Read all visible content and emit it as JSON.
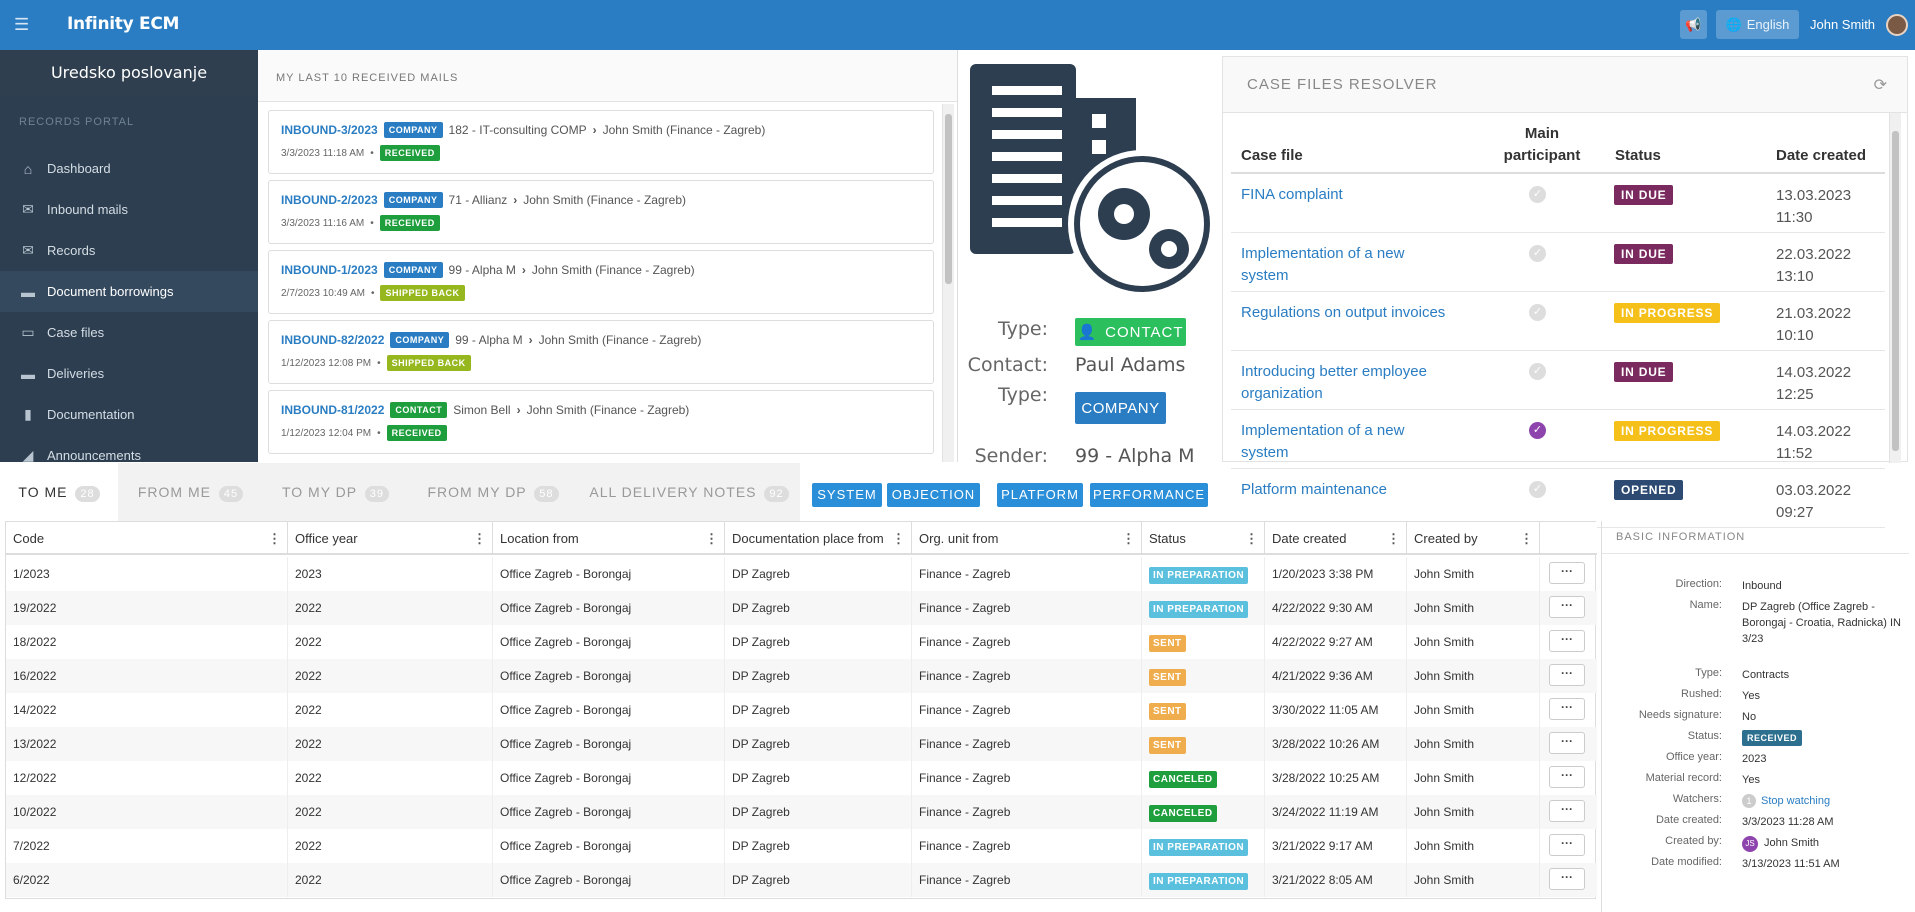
{
  "header": {
    "brand": "Infinity ECM",
    "language": "English",
    "user": "John Smith"
  },
  "sidebar": {
    "title": "Uredsko poslovanje",
    "section": "RECORDS PORTAL",
    "items": [
      {
        "label": "Dashboard",
        "icon": "home-icon"
      },
      {
        "label": "Inbound mails",
        "icon": "envelope-open-icon"
      },
      {
        "label": "Records",
        "icon": "envelope-icon"
      },
      {
        "label": "Document borrowings",
        "icon": "folder-icon"
      },
      {
        "label": "Case files",
        "icon": "folder-open-icon"
      },
      {
        "label": "Deliveries",
        "icon": "folder-icon"
      },
      {
        "label": "Documentation",
        "icon": "book-icon"
      },
      {
        "label": "Announcements",
        "icon": "bullhorn-icon"
      }
    ]
  },
  "mails": {
    "title": "MY LAST 10 RECEIVED MAILS",
    "items": [
      {
        "code": "INBOUND-3/2023",
        "type": "COMPANY",
        "from": "182 - IT-consulting COMP",
        "to": "John Smith (Finance - Zagreb)",
        "date": "3/3/2023 11:18 AM",
        "status": "RECEIVED"
      },
      {
        "code": "INBOUND-2/2023",
        "type": "COMPANY",
        "from": "71 - Allianz",
        "to": "John Smith (Finance - Zagreb)",
        "date": "3/3/2023 11:16 AM",
        "status": "RECEIVED"
      },
      {
        "code": "INBOUND-1/2023",
        "type": "COMPANY",
        "from": "99 - Alpha M",
        "to": "John Smith (Finance - Zagreb)",
        "date": "2/7/2023 10:49 AM",
        "status": "SHIPPED BACK"
      },
      {
        "code": "INBOUND-82/2022",
        "type": "COMPANY",
        "from": "99 - Alpha M",
        "to": "John Smith (Finance - Zagreb)",
        "date": "1/12/2023 12:08 PM",
        "status": "SHIPPED BACK"
      },
      {
        "code": "INBOUND-81/2022",
        "type": "CONTACT",
        "from": "Simon Bell",
        "to": "John Smith (Finance - Zagreb)",
        "date": "1/12/2023 12:04 PM",
        "status": "RECEIVED"
      }
    ]
  },
  "sender_card": {
    "type_label": "Type:",
    "type1": "CONTACT",
    "contact_label": "Contact:",
    "contact": "Paul Adams",
    "type2": "COMPANY",
    "sender_label": "Sender:",
    "sender": "99 - Alpha M"
  },
  "resolver": {
    "title": "CASE FILES RESOLVER",
    "headers": {
      "case_file": "Case file",
      "main1": "Main",
      "main2": "participant",
      "status": "Status",
      "date": "Date created"
    },
    "rows": [
      {
        "name": "FINA complaint",
        "main": false,
        "status": "IN DUE",
        "date": "13.03.2023",
        "time": "11:30"
      },
      {
        "name": "Implementation of a new system",
        "main": false,
        "status": "IN DUE",
        "date": "22.03.2022",
        "time": "13:10"
      },
      {
        "name": "Regulations on output invoices",
        "main": false,
        "status": "IN PROGRESS",
        "date": "21.03.2022",
        "time": "10:10"
      },
      {
        "name": "Introducing better employee organization",
        "main": false,
        "status": "IN DUE",
        "date": "14.03.2022",
        "time": "12:25"
      },
      {
        "name": "Implementation of a new system",
        "main": true,
        "status": "IN PROGRESS",
        "date": "14.03.2022",
        "time": "11:52"
      },
      {
        "name": "Platform maintenance",
        "main": false,
        "status": "OPENED",
        "date": "03.03.2022",
        "time": "09:27"
      }
    ]
  },
  "tabs": [
    {
      "label": "TO ME",
      "count": "28"
    },
    {
      "label": "FROM ME",
      "count": "45"
    },
    {
      "label": "TO MY DP",
      "count": "39"
    },
    {
      "label": "FROM MY DP",
      "count": "58"
    },
    {
      "label": "ALL DELIVERY NOTES",
      "count": "92"
    }
  ],
  "tags": [
    "SYSTEM",
    "OBJECTION",
    "PLATFORM",
    "PERFORMANCE"
  ],
  "grid": {
    "columns": [
      "Code",
      "Office year",
      "Location from",
      "Documentation place from",
      "Org. unit from",
      "Status",
      "Date created",
      "Created by"
    ],
    "rows": [
      {
        "code": "1/2023",
        "year": "2023",
        "loc": "Office Zagreb - Borongaj",
        "dp": "DP Zagreb",
        "org": "Finance - Zagreb",
        "status": "IN PREPARATION",
        "date": "1/20/2023 3:38 PM",
        "by": "John Smith"
      },
      {
        "code": "19/2022",
        "year": "2022",
        "loc": "Office Zagreb - Borongaj",
        "dp": "DP Zagreb",
        "org": "Finance - Zagreb",
        "status": "IN PREPARATION",
        "date": "4/22/2022 9:30 AM",
        "by": "John Smith"
      },
      {
        "code": "18/2022",
        "year": "2022",
        "loc": "Office Zagreb - Borongaj",
        "dp": "DP Zagreb",
        "org": "Finance - Zagreb",
        "status": "SENT",
        "date": "4/22/2022 9:27 AM",
        "by": "John Smith"
      },
      {
        "code": "16/2022",
        "year": "2022",
        "loc": "Office Zagreb - Borongaj",
        "dp": "DP Zagreb",
        "org": "Finance - Zagreb",
        "status": "SENT",
        "date": "4/21/2022 9:36 AM",
        "by": "John Smith"
      },
      {
        "code": "14/2022",
        "year": "2022",
        "loc": "Office Zagreb - Borongaj",
        "dp": "DP Zagreb",
        "org": "Finance - Zagreb",
        "status": "SENT",
        "date": "3/30/2022 11:05 AM",
        "by": "John Smith"
      },
      {
        "code": "13/2022",
        "year": "2022",
        "loc": "Office Zagreb - Borongaj",
        "dp": "DP Zagreb",
        "org": "Finance - Zagreb",
        "status": "SENT",
        "date": "3/28/2022 10:26 AM",
        "by": "John Smith"
      },
      {
        "code": "12/2022",
        "year": "2022",
        "loc": "Office Zagreb - Borongaj",
        "dp": "DP Zagreb",
        "org": "Finance - Zagreb",
        "status": "CANCELED",
        "date": "3/28/2022 10:25 AM",
        "by": "John Smith"
      },
      {
        "code": "10/2022",
        "year": "2022",
        "loc": "Office Zagreb - Borongaj",
        "dp": "DP Zagreb",
        "org": "Finance - Zagreb",
        "status": "CANCELED",
        "date": "3/24/2022 11:19 AM",
        "by": "John Smith"
      },
      {
        "code": "7/2022",
        "year": "2022",
        "loc": "Office Zagreb - Borongaj",
        "dp": "DP Zagreb",
        "org": "Finance - Zagreb",
        "status": "IN PREPARATION",
        "date": "3/21/2022 9:17 AM",
        "by": "John Smith"
      },
      {
        "code": "6/2022",
        "year": "2022",
        "loc": "Office Zagreb - Borongaj",
        "dp": "DP Zagreb",
        "org": "Finance - Zagreb",
        "status": "IN PREPARATION",
        "date": "3/21/2022 8:05 AM",
        "by": "John Smith"
      }
    ]
  },
  "info": {
    "title": "BASIC INFORMATION",
    "rows": [
      {
        "k": "Direction:",
        "v": "Inbound"
      },
      {
        "k": "Name:",
        "v": "DP Zagreb (Office Zagreb - Borongaj - Croatia, Radnicka) IN 3/23"
      },
      {
        "k": "Type:",
        "v": "Contracts"
      },
      {
        "k": "Rushed:",
        "v": "Yes"
      },
      {
        "k": "Needs signature:",
        "v": "No"
      },
      {
        "k": "Status:",
        "v": "RECEIVED"
      },
      {
        "k": "Office year:",
        "v": "2023"
      },
      {
        "k": "Material record:",
        "v": "Yes"
      },
      {
        "k": "Watchers:",
        "v": "Stop watching",
        "count": "1"
      },
      {
        "k": "Date created:",
        "v": "3/3/2023 11:28 AM"
      },
      {
        "k": "Created by:",
        "v": "John Smith",
        "initials": "JS"
      },
      {
        "k": "Date modified:",
        "v": "3/13/2023 11:51 AM"
      }
    ]
  },
  "colors": {
    "primary": "#2a7dc2",
    "sidebar": "#2c3e50",
    "green": "#1e9e3c",
    "purple": "#7a2a5e",
    "yellow": "#f5c01a"
  }
}
